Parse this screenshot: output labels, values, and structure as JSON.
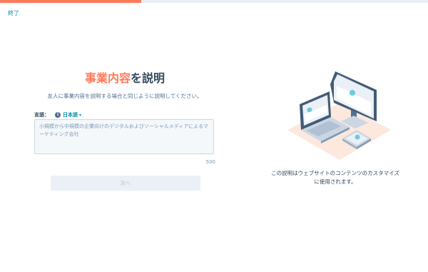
{
  "progress": {
    "fraction": 0.33
  },
  "nav": {
    "exit_label": "終了"
  },
  "main": {
    "title_accent": "事業内容",
    "title_rest": "を説明",
    "subtitle": "友人に事業内容を説明する場合と同じように説明してください。",
    "language_label": "言語：",
    "language_value": "日本語",
    "description_text": "小規模から中規模の企業向けのデジタルおよびソーシャルメディアによるマーケティング会社",
    "char_count": "500",
    "next_label": "次へ"
  },
  "side": {
    "caption_line1": "この説明はウェブサイトのコンテンツのカスタマイズ",
    "caption_line2": "に使用されます。"
  },
  "colors": {
    "accent": "#ff7a59",
    "link": "#0091ae",
    "text": "#33475b",
    "muted": "#7c98b6"
  },
  "icons": [
    "info-icon",
    "chevron-down-icon",
    "devices-illustration"
  ]
}
